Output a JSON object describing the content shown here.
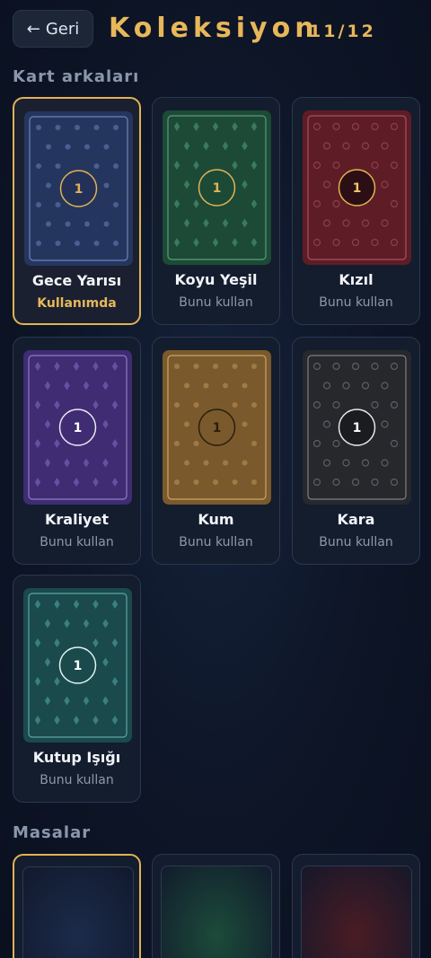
{
  "header": {
    "back_label": "Geri",
    "back_arrow": "←",
    "title": "Koleksiyon",
    "count": "11/12"
  },
  "sections": {
    "card_backs": "Kart arkaları",
    "tables": "Masalar"
  },
  "card_backs": [
    {
      "name": "Gece Yarısı",
      "status": "Kullanımda",
      "selected": true,
      "badge": "1",
      "bg": "#25365e",
      "border": "#6d82b8",
      "motif": "dot",
      "motif_color": "#4a5f91",
      "badge_bg": "#233158",
      "badge_border": "#e2b254",
      "badge_color": "#e2b254"
    },
    {
      "name": "Koyu Yeşil",
      "status": "Bunu kullan",
      "selected": false,
      "badge": "1",
      "bg": "#1c4a36",
      "border": "#5b9a7c",
      "motif": "diamond",
      "motif_color": "#3b7a5d",
      "badge_bg": "#1c4a36",
      "badge_border": "#e2b254",
      "badge_color": "#e2b254"
    },
    {
      "name": "Kızıl",
      "status": "Bunu kullan",
      "selected": false,
      "badge": "1",
      "bg": "#5e1d26",
      "border": "#a4535e",
      "motif": "ring",
      "motif_color": "#8d3e49",
      "badge_bg": "#2b0f14",
      "badge_border": "#e2b254",
      "badge_color": "#f1c56a"
    },
    {
      "name": "Kraliyet",
      "status": "Bunu kullan",
      "selected": false,
      "badge": "1",
      "bg": "#3f2c73",
      "border": "#8e7bc4",
      "motif": "diamond",
      "motif_color": "#6650a3",
      "badge_bg": "#3f2c73",
      "badge_border": "#e8e8f0",
      "badge_color": "#ffffff"
    },
    {
      "name": "Kum",
      "status": "Bunu kullan",
      "selected": false,
      "badge": "1",
      "bg": "#7a5a2c",
      "border": "#caa569",
      "motif": "dot",
      "motif_color": "#a07a44",
      "badge_bg": "#7a5a2c",
      "badge_border": "#2a1e0e",
      "badge_color": "#2a1e0e"
    },
    {
      "name": "Kara",
      "status": "Bunu kullan",
      "selected": false,
      "badge": "1",
      "bg": "#26282c",
      "border": "#7c8088",
      "motif": "ring",
      "motif_color": "#5b5f66",
      "badge_bg": "#1b1c20",
      "badge_border": "#e8e8ec",
      "badge_color": "#ffffff"
    },
    {
      "name": "Kutup Işığı",
      "status": "Bunu kullan",
      "selected": false,
      "badge": "1",
      "bg": "#1a4a4c",
      "border": "#5fa5a2",
      "motif": "diamond",
      "motif_color": "#3b807d",
      "badge_bg": "#1a4a4c",
      "badge_border": "#dff3ef",
      "badge_color": "#ffffff"
    }
  ],
  "tables": [
    {
      "selected": true,
      "color": "#1c2b4a"
    },
    {
      "selected": false,
      "color": "#1c4b3a"
    },
    {
      "selected": false,
      "color": "#4a1c24"
    }
  ]
}
